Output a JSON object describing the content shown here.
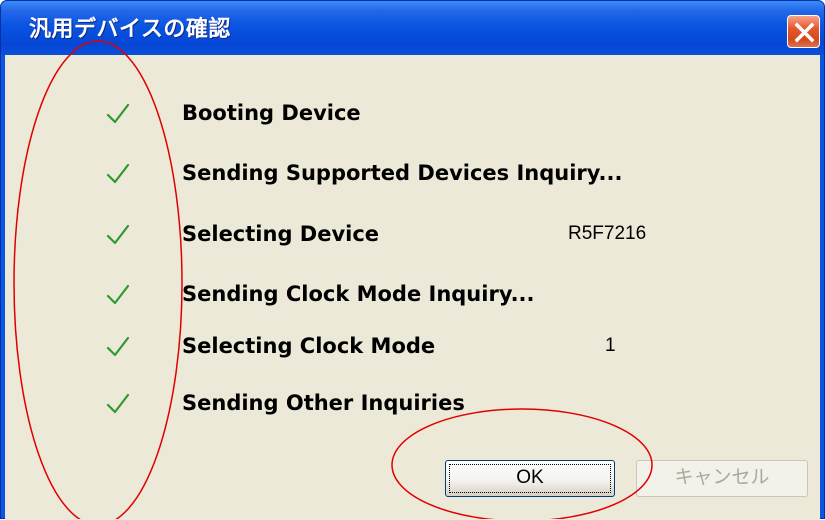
{
  "window": {
    "title": "汎用デバイスの確認"
  },
  "steps": [
    {
      "label": "Booting Device",
      "value": "",
      "icon": "checkmark-icon"
    },
    {
      "label": "Sending Supported Devices Inquiry...",
      "value": "",
      "icon": "checkmark-icon"
    },
    {
      "label": "Selecting Device",
      "value": "R5F7216",
      "icon": "checkmark-icon"
    },
    {
      "label": "Sending Clock Mode Inquiry...",
      "value": "",
      "icon": "checkmark-icon"
    },
    {
      "label": "Selecting Clock Mode",
      "value": "1",
      "icon": "checkmark-icon"
    },
    {
      "label": "Sending Other Inquiries",
      "value": "",
      "icon": "checkmark-icon"
    }
  ],
  "buttons": {
    "ok_label": "OK",
    "cancel_label": "キャンセル",
    "cancel_enabled": false
  },
  "icons": {
    "close": "close-icon"
  },
  "colors": {
    "titlebar": "#0a55e2",
    "client_bg": "#ece9d8",
    "check": "#2e9a2e",
    "close_button": "#e6572c",
    "annotation": "#e00000"
  }
}
